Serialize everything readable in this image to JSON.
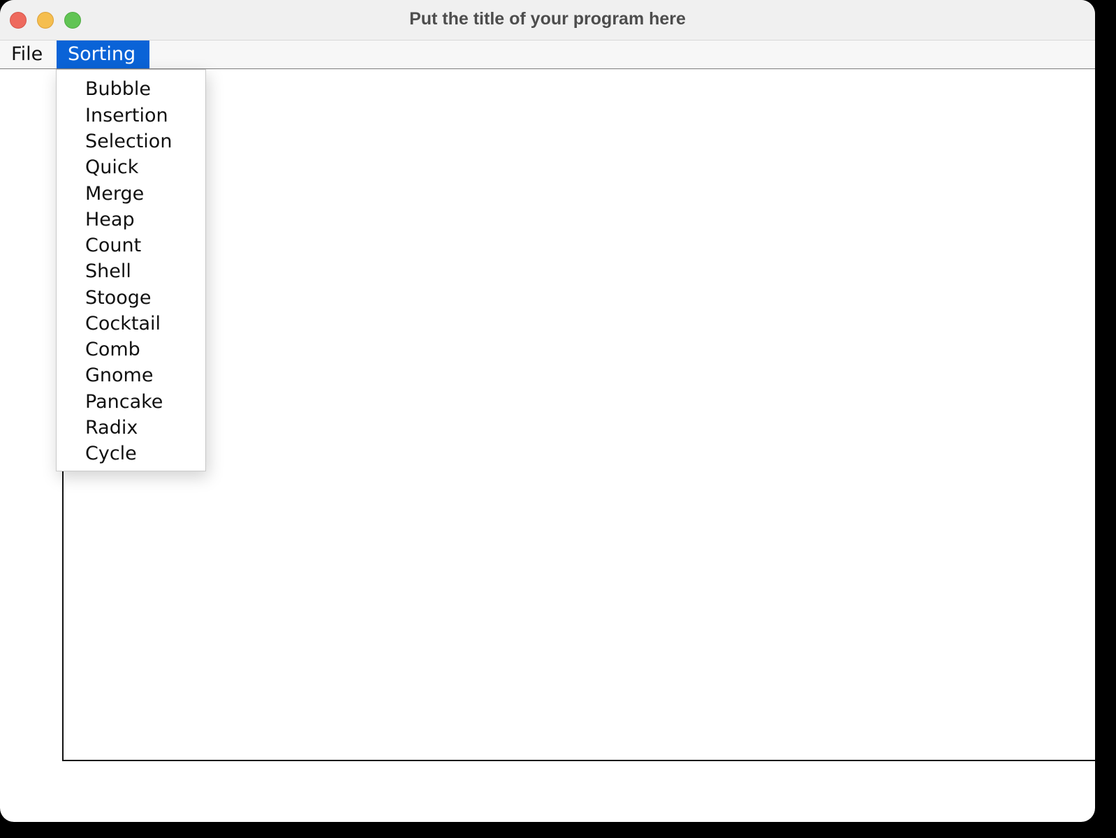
{
  "window": {
    "title": "Put the title of your program here"
  },
  "menubar": {
    "menus": [
      {
        "label": "File"
      },
      {
        "label": "Sorting"
      }
    ]
  },
  "sorting_menu": {
    "items": [
      {
        "label": "Bubble"
      },
      {
        "label": "Insertion"
      },
      {
        "label": "Selection"
      },
      {
        "label": "Quick"
      },
      {
        "label": "Merge"
      },
      {
        "label": "Heap"
      },
      {
        "label": "Count"
      },
      {
        "label": "Shell"
      },
      {
        "label": "Stooge"
      },
      {
        "label": "Cocktail"
      },
      {
        "label": "Comb"
      },
      {
        "label": "Gnome"
      },
      {
        "label": "Pancake"
      },
      {
        "label": "Radix"
      },
      {
        "label": "Cycle"
      }
    ]
  },
  "colors": {
    "menu_highlight": "#0a63d7",
    "close": "#ee6a5e",
    "minimize": "#f5be4f",
    "zoom": "#61c454"
  }
}
